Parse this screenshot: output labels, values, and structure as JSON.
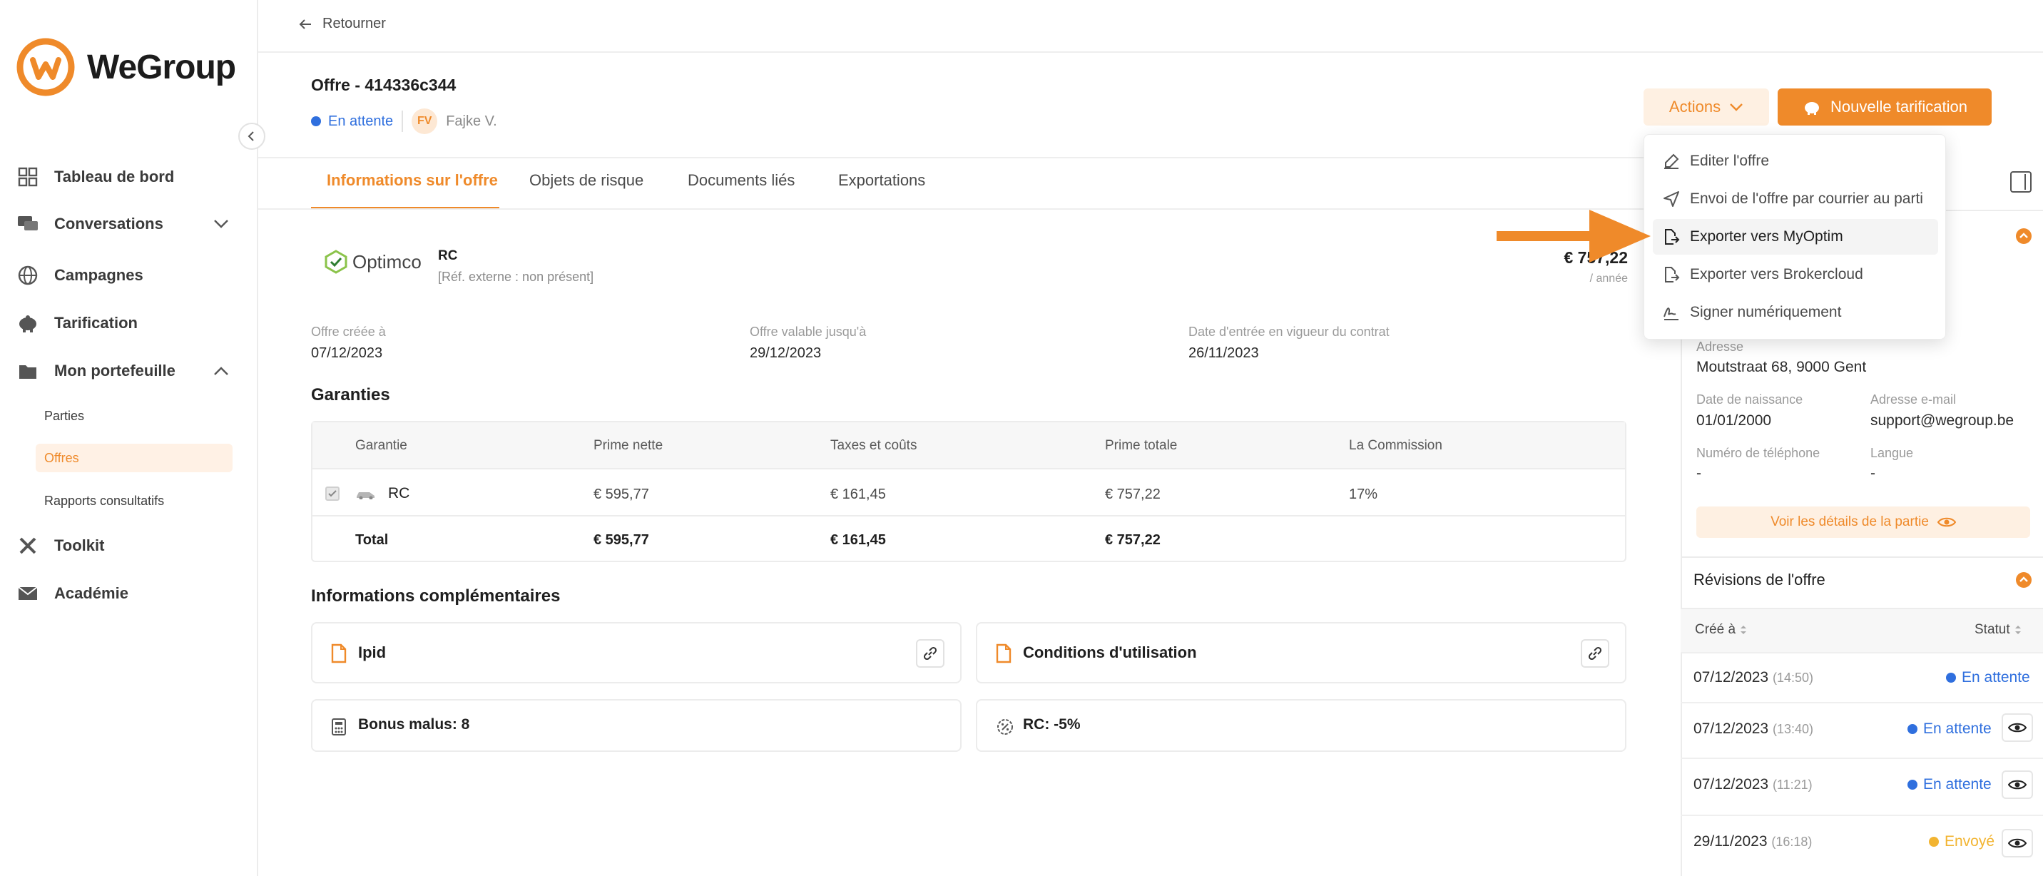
{
  "brand": {
    "name": "WeGroup",
    "accent": "#ef8a2a"
  },
  "nav": {
    "items": [
      {
        "label": "Tableau de bord",
        "icon": "dashboard-icon"
      },
      {
        "label": "Conversations",
        "icon": "chat-icon"
      },
      {
        "label": "Campagnes",
        "icon": "globe-icon"
      },
      {
        "label": "Tarification",
        "icon": "piggy-icon"
      },
      {
        "label": "Mon portefeuille",
        "icon": "folder-icon"
      },
      {
        "label": "Toolkit",
        "icon": "tools-icon"
      },
      {
        "label": "Académie",
        "icon": "mail-icon"
      }
    ],
    "sub_items": [
      "Parties",
      "Offres",
      "Rapports consultatifs"
    ]
  },
  "header": {
    "back_label": "Retourner",
    "offer_title": "Offre - 414336c344",
    "status": "En attente",
    "initials": "FV",
    "user_name": "Fajke V.",
    "actions_label": "Actions",
    "new_label": "Nouvelle tarification"
  },
  "tabs": [
    "Informations sur l'offre",
    "Objets de risque",
    "Documents liés",
    "Exportations"
  ],
  "offer": {
    "insurer": "Optimco",
    "product": "RC",
    "ext_ref": "[Réf. externe : non présent]",
    "price": "€ 757,22",
    "per": "/ année",
    "created_label": "Offre créée à",
    "created": "07/12/2023",
    "valid_label": "Offre valable jusqu'à",
    "valid": "29/12/2023",
    "effective_label": "Date d'entrée en vigueur du contrat",
    "effective": "26/11/2023"
  },
  "guarantees": {
    "title": "Garanties",
    "headers": [
      "Garantie",
      "Prime nette",
      "Taxes et coûts",
      "Prime totale",
      "La Commission"
    ],
    "row": [
      "RC",
      "€ 595,77",
      "€ 161,45",
      "€ 757,22",
      "17%"
    ],
    "total": [
      "Total",
      "€ 595,77",
      "€ 161,45",
      "€ 757,22"
    ]
  },
  "extra": {
    "title": "Informations complémentaires",
    "doc1": "Ipid",
    "doc2": "Conditions d'utilisation",
    "bonus": "Bonus malus: 8",
    "rc": "RC: -5%"
  },
  "party": {
    "address_label": "Adresse",
    "address": "Moutstraat 68, 9000 Gent",
    "birth_label": "Date de naissance",
    "birth": "01/01/2000",
    "email_label": "Adresse e-mail",
    "email": "support@wegroup.be",
    "phone_label": "Numéro de téléphone",
    "phone": "-",
    "lang_label": "Langue",
    "lang": "-",
    "details_label": "Voir les détails de la partie"
  },
  "revisions": {
    "title": "Révisions de l'offre",
    "col_created": "Créé à",
    "col_status": "Statut",
    "rows": [
      {
        "date": "07/12/2023",
        "time": "(14:50)",
        "status": "En attente"
      },
      {
        "date": "07/12/2023",
        "time": "(13:40)",
        "status": "En attente"
      },
      {
        "date": "07/12/2023",
        "time": "(11:21)",
        "status": "En attente"
      },
      {
        "date": "29/11/2023",
        "time": "(16:18)",
        "status": "Envoyé"
      }
    ]
  },
  "dropdown": {
    "items": [
      "Editer l'offre",
      "Envoi de l'offre par courrier au parti",
      "Exporter vers MyOptim",
      "Exporter vers Brokercloud",
      "Signer numériquement"
    ]
  },
  "colors": {
    "accent": "#ef8a2a",
    "pending": "#2f6fde",
    "sent": "#f2b431"
  }
}
